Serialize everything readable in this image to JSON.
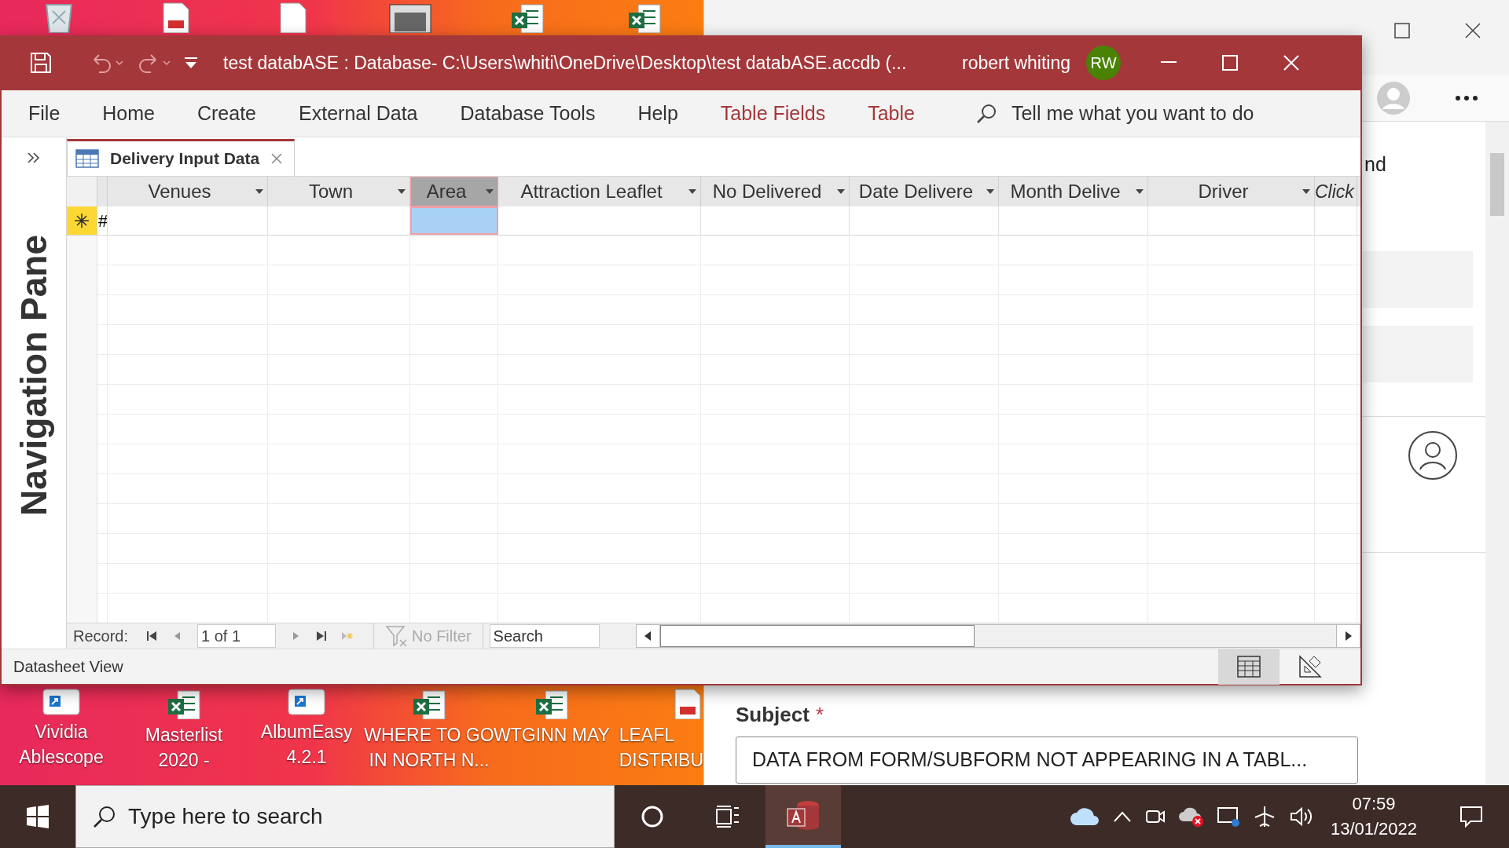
{
  "top_desktop_icons": [
    {
      "kind": "bin"
    },
    {
      "kind": "pdf"
    },
    {
      "kind": "doc"
    },
    {
      "kind": "photo"
    },
    {
      "kind": "excel"
    },
    {
      "kind": "excel"
    }
  ],
  "access_window": {
    "title": "test databASE : Database- C:\\Users\\whiti\\OneDrive\\Desktop\\test databASE.accdb (...",
    "user_name": "robert whiting",
    "user_initials": "RW",
    "ribbon_tabs": [
      {
        "label": "File",
        "contextual": false
      },
      {
        "label": "Home",
        "contextual": false
      },
      {
        "label": "Create",
        "contextual": false
      },
      {
        "label": "External Data",
        "contextual": false
      },
      {
        "label": "Database Tools",
        "contextual": false
      },
      {
        "label": "Help",
        "contextual": false
      },
      {
        "label": "Table Fields",
        "contextual": true
      },
      {
        "label": "Table",
        "contextual": true
      }
    ],
    "tell_me": "Tell me what you want to do",
    "nav_pane_label": "Navigation Pane",
    "document_tab": {
      "label": "Delivery Input Data",
      "selected": true
    },
    "columns": [
      {
        "kind": "narrow",
        "selected": false
      },
      {
        "kind": "field",
        "label": "Venues",
        "selected": false
      },
      {
        "kind": "field",
        "label": "Town",
        "selected": false
      },
      {
        "kind": "field",
        "label": "Area",
        "selected": true
      },
      {
        "kind": "field",
        "label": "Attraction Leaflet",
        "selected": false
      },
      {
        "kind": "field",
        "label": "No Delivered",
        "selected": false
      },
      {
        "kind": "field",
        "label": "Date Delivere",
        "selected": false
      },
      {
        "kind": "field",
        "label": "Month Delive",
        "selected": false
      },
      {
        "kind": "field",
        "label": "Driver",
        "selected": false
      },
      {
        "kind": "add",
        "label": "Click",
        "selected": false
      }
    ],
    "new_row": {
      "first_cell": "#"
    },
    "record_nav": {
      "label": "Record:",
      "position": "1 of 1",
      "filter": "No Filter",
      "filter_active": false,
      "search_placeholder": "Search"
    },
    "status": "Datasheet View",
    "views": [
      {
        "kind": "datasheet",
        "selected": true
      },
      {
        "kind": "design",
        "selected": false
      }
    ]
  },
  "desktop_icons": [
    {
      "kind": "shortcut",
      "lines": [
        "Vividia",
        "Ablescope"
      ]
    },
    {
      "kind": "excel",
      "lines": [
        "Masterlist",
        "2020 -"
      ]
    },
    {
      "kind": "shortcut",
      "lines": [
        "AlbumEasy",
        "4.2.1"
      ]
    },
    {
      "kind": "excel",
      "lines": [
        "WHERE TO GO",
        "IN NORTH N..."
      ]
    },
    {
      "kind": "excel",
      "lines": [
        "WTGINN MAY"
      ]
    },
    {
      "kind": "pdf",
      "lines": [
        "LEAFL",
        "DISTRIBU"
      ]
    }
  ],
  "browser": {
    "partial_text": "nd",
    "subject_label": "Subject",
    "required_mark": "*",
    "subject_value": "DATA FROM FORM/SUBFORM NOT APPEARING IN A TABL..."
  },
  "taskbar": {
    "search_placeholder": "Type here to search",
    "time": "07:59",
    "date": "13/01/2022"
  }
}
